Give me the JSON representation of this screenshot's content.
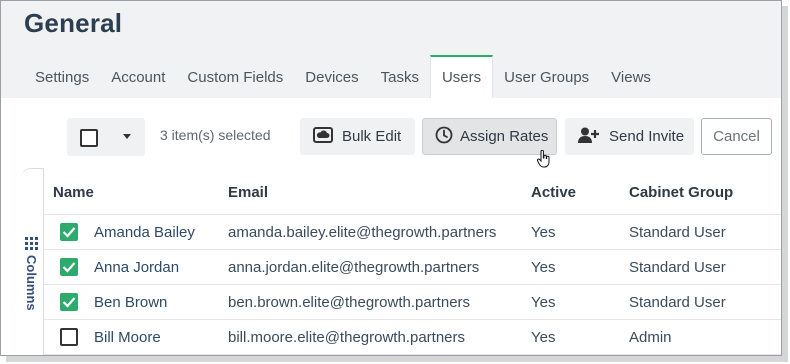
{
  "page": {
    "title": "General"
  },
  "tabs": [
    {
      "label": "Settings",
      "active": false
    },
    {
      "label": "Account",
      "active": false
    },
    {
      "label": "Custom Fields",
      "active": false
    },
    {
      "label": "Devices",
      "active": false
    },
    {
      "label": "Tasks",
      "active": false
    },
    {
      "label": "Users",
      "active": true
    },
    {
      "label": "User Groups",
      "active": false
    },
    {
      "label": "Views",
      "active": false
    }
  ],
  "toolbar": {
    "selected_count": "3 item(s) selected",
    "bulk_edit_label": "Bulk Edit",
    "assign_rates_label": "Assign Rates",
    "send_invite_label": "Send Invite",
    "cancel_label": "Cancel"
  },
  "side_panel": {
    "columns_label": "Columns"
  },
  "table": {
    "headers": {
      "name": "Name",
      "email": "Email",
      "active": "Active",
      "group": "Cabinet Group"
    },
    "rows": [
      {
        "checked": true,
        "name": "Amanda Bailey",
        "email": "amanda.bailey.elite@thegrowth.partners",
        "active": "Yes",
        "group": "Standard User"
      },
      {
        "checked": true,
        "name": "Anna Jordan",
        "email": "anna.jordan.elite@thegrowth.partners",
        "active": "Yes",
        "group": "Standard User"
      },
      {
        "checked": true,
        "name": "Ben Brown",
        "email": "ben.brown.elite@thegrowth.partners",
        "active": "Yes",
        "group": "Standard User"
      },
      {
        "checked": false,
        "name": "Bill Moore",
        "email": "bill.moore.elite@thegrowth.partners",
        "active": "Yes",
        "group": "Admin"
      }
    ]
  },
  "colors": {
    "accent": "#2eaa6c",
    "title": "#2c3e50"
  },
  "icons": {
    "bulk_edit": "cloud-icon",
    "assign_rates": "clock-icon",
    "send_invite": "user-plus-icon",
    "columns": "grid-icon",
    "select_all": "checkbox-icon"
  }
}
